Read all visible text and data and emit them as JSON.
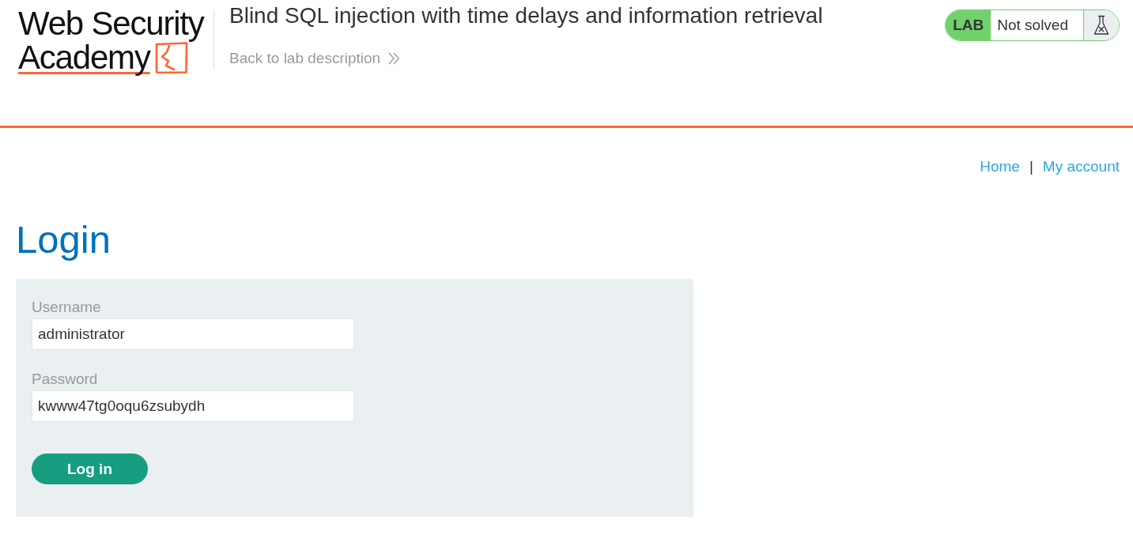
{
  "header": {
    "logo": {
      "line_1": "Web Security",
      "line_2": "Academy"
    },
    "title": "Blind SQL injection with time delays and information retrieval",
    "back_link": "Back to lab description",
    "lab_status": {
      "badge": "LAB",
      "status": "Not solved",
      "solved": false
    }
  },
  "nav": {
    "links": [
      {
        "label": "Home"
      },
      {
        "label": "My account"
      }
    ],
    "separator": "|"
  },
  "login": {
    "heading": "Login",
    "fields": [
      {
        "label": "Username",
        "value": "administrator"
      },
      {
        "label": "Password",
        "value": "kwww47tg0oqu6zsubydh"
      }
    ],
    "button": "Log in"
  }
}
